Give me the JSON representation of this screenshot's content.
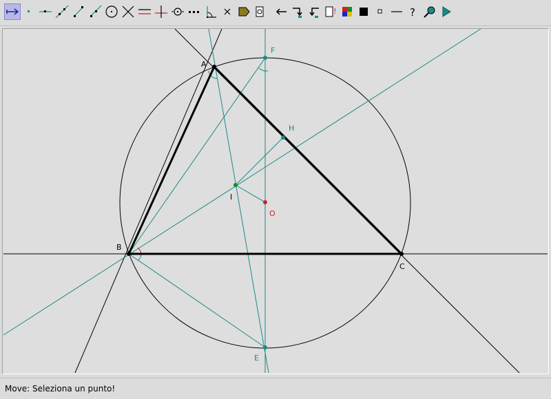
{
  "toolbar": {
    "tools": [
      {
        "name": "move-tool-icon",
        "selected": true
      },
      {
        "name": "point-tool-icon"
      },
      {
        "name": "point-on-object-tool-icon"
      },
      {
        "name": "line-tool-icon"
      },
      {
        "name": "segment-tool-icon"
      },
      {
        "name": "ray-tool-icon"
      },
      {
        "name": "circle-tool-icon"
      },
      {
        "name": "intersection-tool-icon"
      },
      {
        "name": "parallel-tool-icon"
      },
      {
        "name": "perpendicular-tool-icon"
      },
      {
        "name": "midpoint-tool-icon"
      },
      {
        "name": "distance-tool-icon"
      },
      {
        "name": "angle-tool-icon"
      },
      {
        "name": "delete-tool-icon"
      },
      {
        "name": "polygon-fill-tool-icon"
      },
      {
        "name": "macro-tool-icon"
      },
      {
        "name": "undo-tool-icon"
      },
      {
        "name": "redo-tool-icon"
      },
      {
        "name": "back-tool-icon"
      },
      {
        "name": "info-tool-icon"
      },
      {
        "name": "color-tool-icon"
      },
      {
        "name": "fill-black-tool-icon"
      },
      {
        "name": "point-style-tool-icon"
      },
      {
        "name": "line-style-tool-icon"
      },
      {
        "name": "help-tool-icon"
      },
      {
        "name": "zoom-tool-icon"
      },
      {
        "name": "play-tool-icon"
      }
    ]
  },
  "colors": {
    "black": "#000000",
    "teal": "#1a8a8a",
    "red": "#cc2222",
    "green": "#1a8a1a"
  },
  "points": {
    "A": "A",
    "B": "B",
    "C": "C",
    "E": "E",
    "F": "F",
    "H": "H",
    "I": "I",
    "O": "O"
  },
  "status": {
    "text": "Move: Seleziona un punto!"
  }
}
